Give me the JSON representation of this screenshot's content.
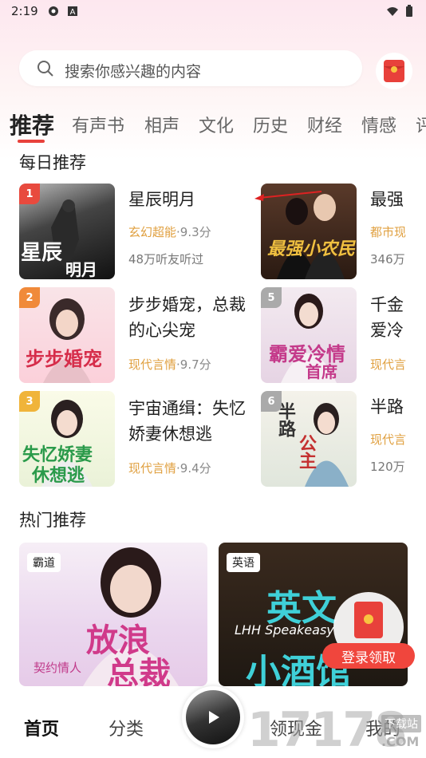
{
  "status": {
    "time": "2:19"
  },
  "search": {
    "placeholder": "搜索你感兴趣的内容"
  },
  "tabs": [
    "推荐",
    "有声书",
    "相声",
    "文化",
    "历史",
    "财经",
    "情感",
    "评"
  ],
  "sections": {
    "daily": "每日推荐",
    "hot": "热门推荐"
  },
  "books": [
    {
      "rank": "1",
      "title": "星辰明月",
      "genre": "玄幻超能",
      "score": "·9.3分",
      "listeners": "48万听友听过",
      "rank_color": "#e84a3e",
      "cover_text": "星辰 明月"
    },
    {
      "rank": "2",
      "title": "步步婚宠，总裁的心尖宠",
      "genre": "现代言情",
      "score": "·9.7分",
      "listeners": "",
      "rank_color": "#f08a3a",
      "cover_text": "步步婚宠"
    },
    {
      "rank": "3",
      "title": "宇宙通缉：失忆娇妻休想逃",
      "genre": "现代言情",
      "score": "·9.4分",
      "listeners": "",
      "rank_color": "#f0b43a",
      "cover_text": "失忆娇妻 休想逃"
    },
    {
      "rank": "",
      "title": "最强",
      "genre": "都市现",
      "score": "",
      "listeners": "346万",
      "rank_color": "#999",
      "cover_text": "最强小农民"
    },
    {
      "rank": "5",
      "title": "千金爱冷",
      "genre": "现代言",
      "score": "",
      "listeners": "",
      "rank_color": "#aaa",
      "cover_text": "霸爱冷情首席"
    },
    {
      "rank": "6",
      "title": "半路",
      "genre": "现代言",
      "score": "",
      "listeners": "120万",
      "rank_color": "#aaa",
      "cover_text": "半路公主"
    }
  ],
  "hot": [
    {
      "tag": "霸道",
      "cover_text": "放浪总裁",
      "sub": "契约情人"
    },
    {
      "tag": "英语",
      "cover_text": "英文小酒馆",
      "sub": "LHH Speakeasy"
    }
  ],
  "float": {
    "button": "登录领取"
  },
  "nav": {
    "home": "首页",
    "category": "分类",
    "cash": "领现金",
    "mine": "我的"
  },
  "watermark": {
    "text": "17178",
    "sub": "下载站",
    "domain": ".COM"
  },
  "colors": {
    "accent": "#e8413b",
    "genre": "#e0a040"
  }
}
